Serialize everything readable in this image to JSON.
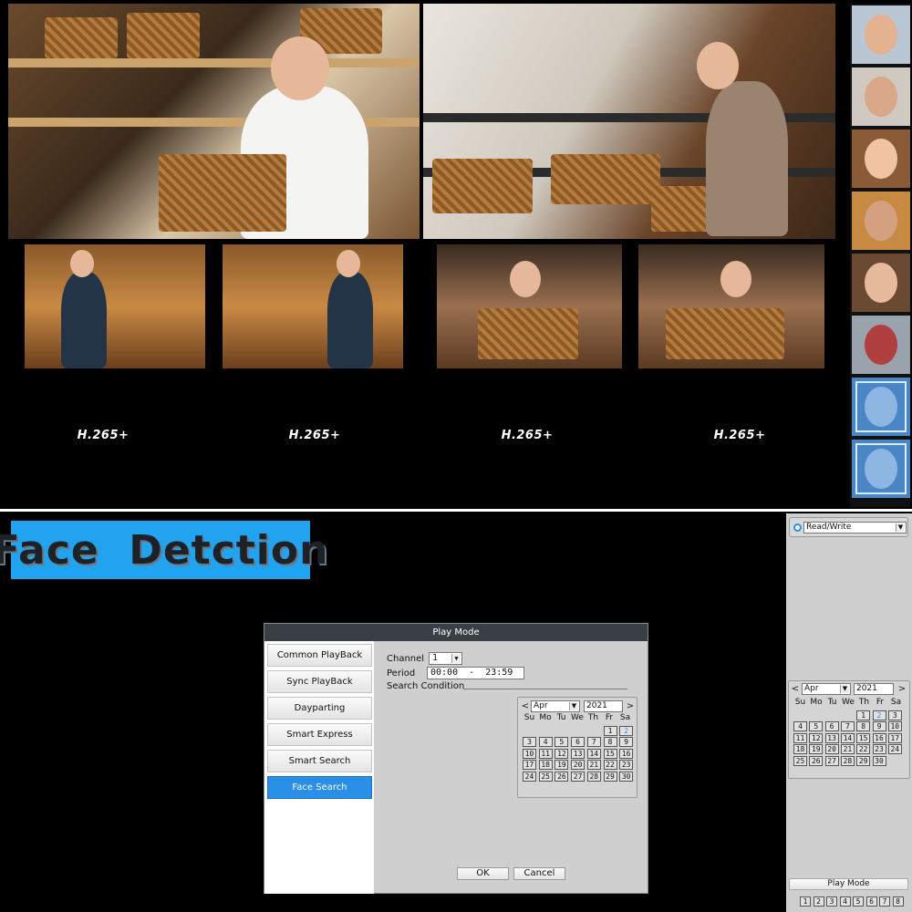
{
  "video_wall": {
    "codec_labels": [
      "H.265+",
      "H.265+",
      "H.265+",
      "H.265+"
    ]
  },
  "banner": {
    "title": "Face  Detction"
  },
  "play_mode_dialog": {
    "title": "Play Mode",
    "modes": [
      {
        "label": "Common PlayBack",
        "active": false
      },
      {
        "label": "Sync PlayBack",
        "active": false
      },
      {
        "label": "Dayparting",
        "active": false
      },
      {
        "label": "Smart Express",
        "active": false
      },
      {
        "label": "Smart Search",
        "active": false
      },
      {
        "label": "Face Search",
        "active": true
      }
    ],
    "channel_label": "Channel",
    "channel_value": "1",
    "period_label": "Period",
    "period_value": "00:00  -  23:59",
    "search_condition_label": "Search Condition",
    "calendar": {
      "prev": "<",
      "next": ">",
      "month": "Apr",
      "year": "2021",
      "weekdays": [
        "Su",
        "Mo",
        "Tu",
        "We",
        "Th",
        "Fr",
        "Sa"
      ],
      "first_weekday_index": 5,
      "days": [
        "1",
        "2",
        "3",
        "4",
        "5",
        "6",
        "7",
        "8",
        "9",
        "10",
        "11",
        "12",
        "13",
        "14",
        "15",
        "16",
        "17",
        "18",
        "19",
        "20",
        "21",
        "22",
        "23",
        "24",
        "25",
        "26",
        "27",
        "28",
        "29",
        "30"
      ],
      "selected_day": "2"
    },
    "ok_label": "OK",
    "cancel_label": "Cancel"
  },
  "right_panel": {
    "mode_value": "Read/Write",
    "calendar": {
      "prev": "<",
      "next": ">",
      "month": "Apr",
      "year": "2021",
      "weekdays": [
        "Su",
        "Mo",
        "Tu",
        "We",
        "Th",
        "Fr",
        "Sa"
      ],
      "first_weekday_index": 4,
      "days": [
        "1",
        "2",
        "3",
        "4",
        "5",
        "6",
        "7",
        "8",
        "9",
        "10",
        "11",
        "12",
        "13",
        "14",
        "15",
        "16",
        "17",
        "18",
        "19",
        "20",
        "21",
        "22",
        "23",
        "24",
        "25",
        "26",
        "27",
        "28",
        "29",
        "30"
      ],
      "selected_day": "2"
    },
    "play_mode_label": "Play Mode",
    "channel_buttons": [
      "1",
      "2",
      "3",
      "4",
      "5",
      "6",
      "7",
      "8"
    ]
  },
  "colors": {
    "accent": "#2a8fe6",
    "banner": "#21a3f0"
  }
}
